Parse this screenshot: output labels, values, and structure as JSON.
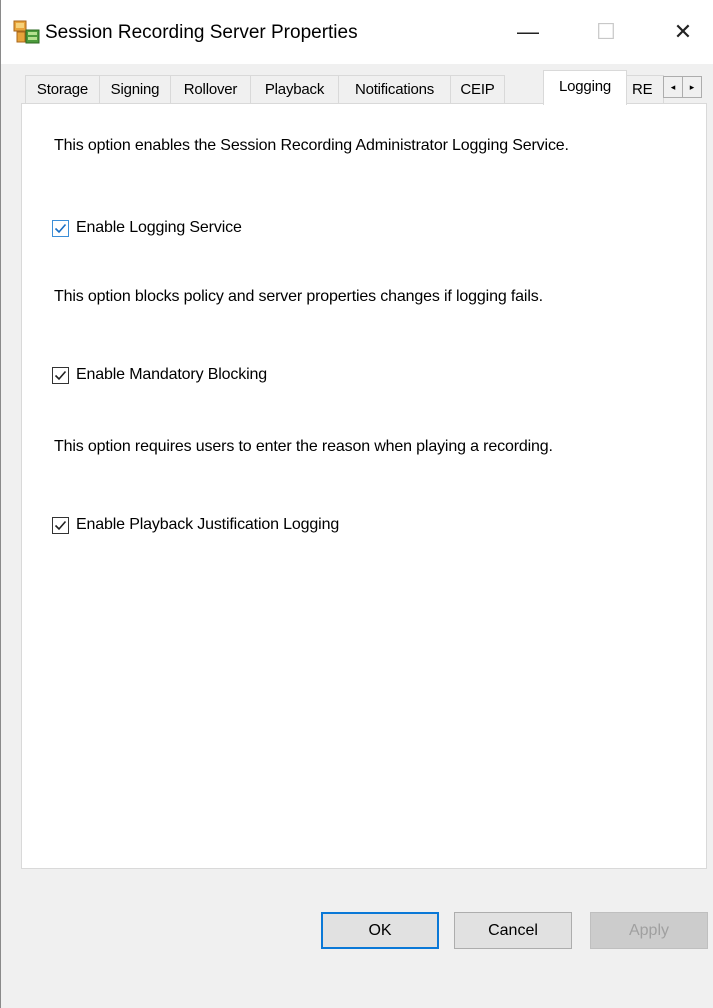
{
  "window": {
    "title": "Session Recording Server Properties",
    "controls": {
      "minimize": "—",
      "maximize": "☐",
      "close": "✕"
    }
  },
  "tabs": [
    {
      "label": "Storage"
    },
    {
      "label": "Signing"
    },
    {
      "label": "Rollover"
    },
    {
      "label": "Playback"
    },
    {
      "label": "Notifications"
    },
    {
      "label": "CEIP"
    },
    {
      "label": "Logging",
      "active": true
    },
    {
      "label": "RE"
    }
  ],
  "tab_scroll": {
    "left": "◂",
    "right": "▸"
  },
  "logging": {
    "logging_service_desc": "This option enables the Session Recording Administrator Logging Service.",
    "logging_service_label": "Enable Logging Service",
    "logging_service_checked": true,
    "mandatory_blocking_desc": "This option blocks policy and server properties changes if logging fails.",
    "mandatory_blocking_label": "Enable Mandatory Blocking",
    "mandatory_blocking_checked": true,
    "playback_justification_desc": "This option requires users to enter the reason when playing a recording.",
    "playback_justification_label": "Enable Playback Justification Logging",
    "playback_justification_checked": true
  },
  "buttons": {
    "ok": "OK",
    "cancel": "Cancel",
    "apply": "Apply"
  },
  "colors": {
    "focus_accent": "#0a78d7",
    "checkbox_focus": "#3c8fd8"
  }
}
